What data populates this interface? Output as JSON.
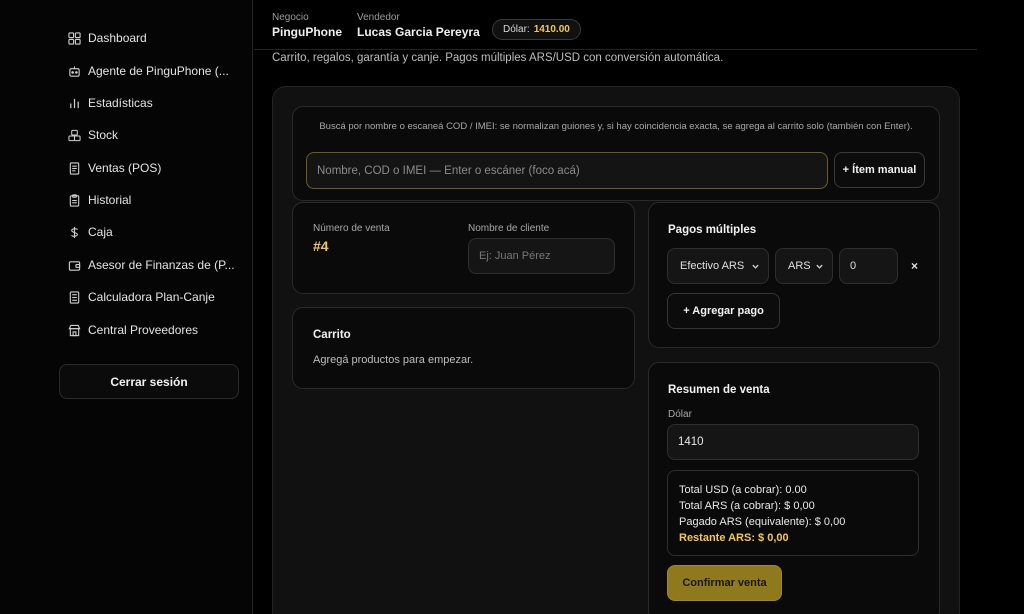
{
  "sidebar": {
    "items": [
      {
        "label": "Dashboard",
        "icon": "dashboard-icon"
      },
      {
        "label": "Agente de PinguPhone (...",
        "icon": "bot-icon"
      },
      {
        "label": "Estadísticas",
        "icon": "bar-chart-icon"
      },
      {
        "label": "Stock",
        "icon": "boxes-icon"
      },
      {
        "label": "Ventas (POS)",
        "icon": "receipt-icon"
      },
      {
        "label": "Historial",
        "icon": "clipboard-icon"
      },
      {
        "label": "Caja",
        "icon": "dollar-icon"
      },
      {
        "label": "Asesor de Finanzas de (P...",
        "icon": "wallet-icon"
      },
      {
        "label": "Calculadora Plan-Canje",
        "icon": "calculator-icon"
      },
      {
        "label": "Central Proveedores",
        "icon": "store-icon"
      }
    ],
    "logout_label": "Cerrar sesión"
  },
  "header": {
    "business_label": "Negocio",
    "business_value": "PinguPhone",
    "seller_label": "Vendedor",
    "seller_value": "Lucas Garcia Pereyra",
    "dollar_label": "Dólar:",
    "dollar_value": "1410.00",
    "subtitle": "Carrito, regalos, garantía y canje. Pagos múltiples ARS/USD con conversión automática."
  },
  "search": {
    "hint": "Buscá por nombre o escaneá COD / IMEI: se normalizan guiones y, si hay coincidencia exacta, se agrega al carrito solo (también con Enter).",
    "placeholder": "Nombre, COD o IMEI — Enter o escáner (foco acá)",
    "manual_button": "+ Ítem manual"
  },
  "sale": {
    "number_label": "Número de venta",
    "number_value": "#4",
    "client_label": "Nombre de cliente",
    "client_placeholder": "Ej: Juan Pérez"
  },
  "cart": {
    "title": "Carrito",
    "empty_text": "Agregá productos para empezar."
  },
  "payments": {
    "title": "Pagos múltiples",
    "method_value": "Efectivo ARS",
    "currency_value": "ARS",
    "amount_value": "0",
    "remove_label": "×",
    "add_button": "+ Agregar pago"
  },
  "summary": {
    "title": "Resumen de venta",
    "dollar_label": "Dólar",
    "dollar_value": "1410",
    "total_usd": "Total USD (a cobrar): 0.00",
    "total_ars": "Total ARS (a cobrar): $ 0,00",
    "paid_ars": "Pagado ARS (equivalente): $ 0,00",
    "remaining_ars": "Restante ARS: $ 0,00",
    "confirm_button": "Confirmar venta"
  },
  "colors": {
    "accent": "#f2c94c",
    "confirm_bg": "#8e7a1c",
    "background": "#000000",
    "panel": "#111111"
  }
}
